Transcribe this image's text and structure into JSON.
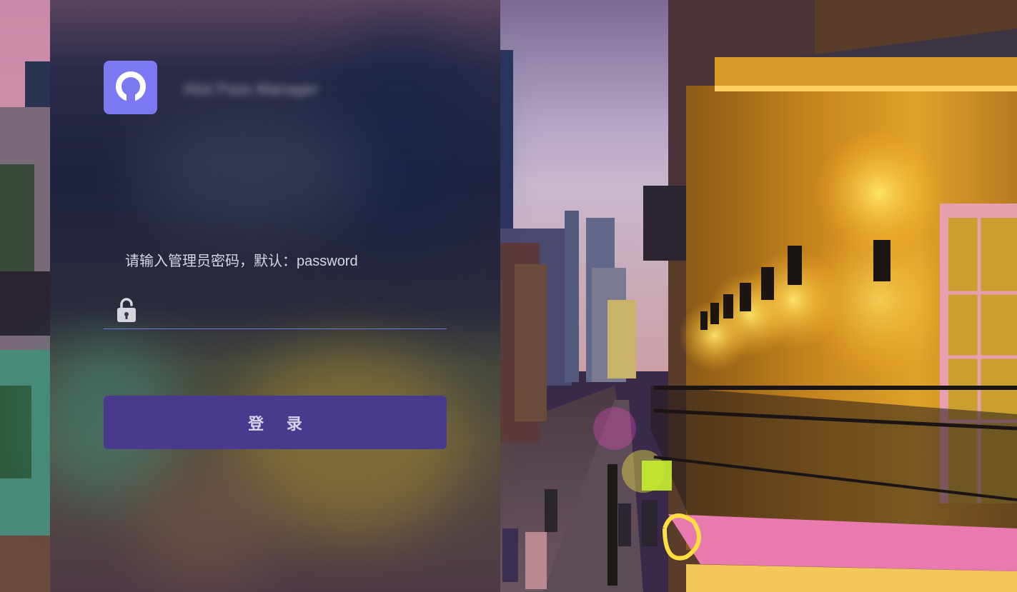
{
  "brand": {
    "name": "Alist Pass Manager",
    "logo_icon": "circle-logo-icon",
    "logo_color": "#7b79f2"
  },
  "login": {
    "password_label": "请输入管理员密码，默认：password",
    "password_value": "",
    "lock_icon": "unlock-icon",
    "submit_label": "登 录",
    "accent_color": "#4a3a8e"
  },
  "background": {
    "description_icon": "city-street-photo"
  }
}
